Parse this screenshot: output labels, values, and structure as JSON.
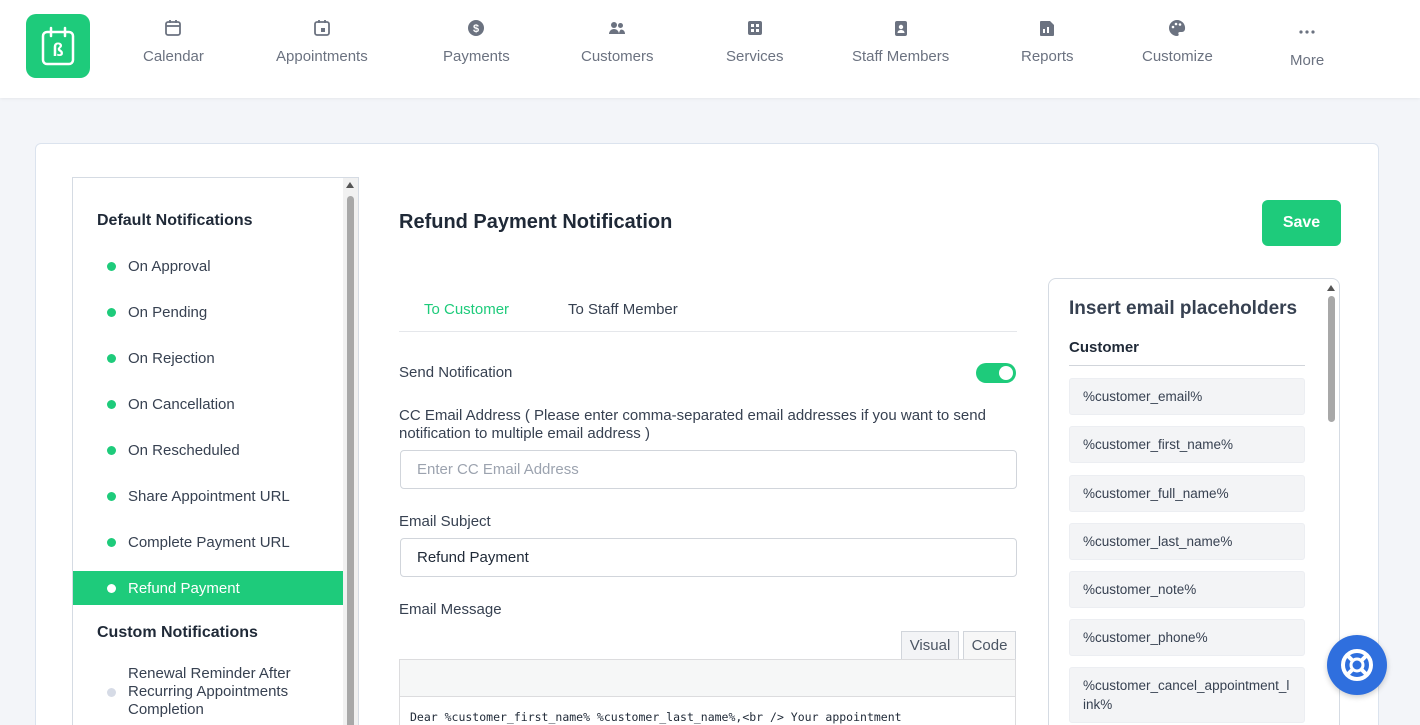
{
  "brand": {
    "accent": "#1ecb7b",
    "help_color": "#2f6fde"
  },
  "nav": [
    {
      "label": "Calendar",
      "icon": "calendar-icon"
    },
    {
      "label": "Appointments",
      "icon": "calendar-event-icon"
    },
    {
      "label": "Payments",
      "icon": "dollar-circle-icon"
    },
    {
      "label": "Customers",
      "icon": "users-icon"
    },
    {
      "label": "Services",
      "icon": "services-grid-icon"
    },
    {
      "label": "Staff Members",
      "icon": "id-badge-icon"
    },
    {
      "label": "Reports",
      "icon": "report-icon"
    },
    {
      "label": "Customize",
      "icon": "palette-icon"
    },
    {
      "label": "More",
      "icon": "more-dots-icon"
    }
  ],
  "sidebar": {
    "default_heading": "Default Notifications",
    "items": [
      {
        "label": "On Approval"
      },
      {
        "label": "On Pending"
      },
      {
        "label": "On Rejection"
      },
      {
        "label": "On Cancellation"
      },
      {
        "label": "On Rescheduled"
      },
      {
        "label": "Share Appointment URL"
      },
      {
        "label": "Complete Payment URL"
      },
      {
        "label": "Refund Payment",
        "active": true
      }
    ],
    "custom_heading": "Custom Notifications",
    "custom_items": [
      {
        "label": "Renewal Reminder After Recurring Appointments Completion"
      }
    ]
  },
  "main": {
    "title": "Refund Payment Notification",
    "save_label": "Save",
    "tabs": [
      {
        "label": "To Customer",
        "active": true
      },
      {
        "label": "To Staff Member",
        "active": false
      }
    ],
    "send_notification_label": "Send Notification",
    "send_notification_on": true,
    "cc_label": "CC Email Address ( Please enter comma-separated email addresses if you want to send notification to multiple email address )",
    "cc_placeholder": "Enter CC Email Address",
    "cc_value": "",
    "subject_label": "Email Subject",
    "subject_value": "Refund Payment",
    "message_label": "Email Message",
    "editor_tabs": {
      "visual": "Visual",
      "code": "Code"
    },
    "message_body": "Dear %customer_first_name% %customer_last_name%,<br /> Your appointment"
  },
  "placeholders": {
    "title": "Insert email placeholders",
    "group": "Customer",
    "items": [
      "%customer_email%",
      "%customer_first_name%",
      "%customer_full_name%",
      "%customer_last_name%",
      "%customer_note%",
      "%customer_phone%",
      "%customer_cancel_appointment_link%"
    ]
  }
}
